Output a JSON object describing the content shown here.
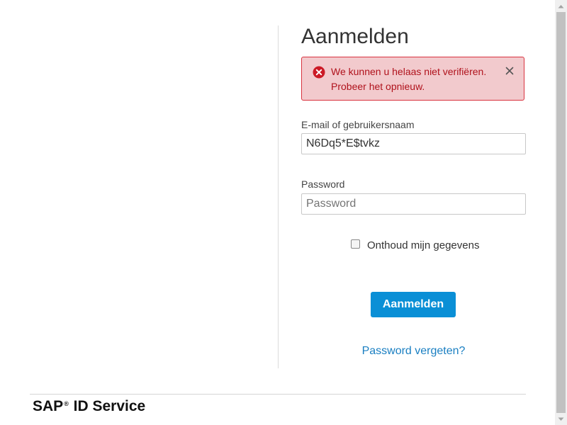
{
  "form": {
    "title": "Aanmelden",
    "alert": {
      "message": "We kunnen u helaas niet verifiëren. Probeer het opnieuw.",
      "icon": "error-circle-icon",
      "close_icon": "close-icon",
      "color": "#b0121c",
      "background": "#f2cacd"
    },
    "email": {
      "label": "E-mail of gebruikersnaam",
      "value": "N6Dq5*E$tvkz"
    },
    "password": {
      "label": "Password",
      "placeholder": "Password",
      "value": ""
    },
    "remember": {
      "label": "Onthoud mijn gegevens",
      "checked": false
    },
    "submit_label": "Aanmelden",
    "forgot_link": "Password vergeten?",
    "accent": "#0a8fd6",
    "link_color": "#1a7fc2"
  },
  "footer": {
    "brand_prefix": "SAP",
    "brand_mark": "®",
    "brand_suffix": " ID Service"
  }
}
